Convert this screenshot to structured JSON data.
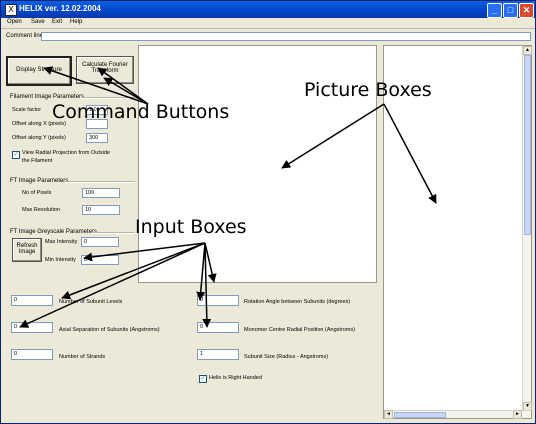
{
  "window": {
    "title": "HELIX ver. 12.02.2004",
    "app_icon": "X",
    "minimize_glyph": "_",
    "maximize_glyph": "□",
    "close_glyph": "✕"
  },
  "menu": [
    "Open",
    "Save",
    "Exit",
    "Help"
  ],
  "comment": {
    "label": "Comment line:",
    "value": ""
  },
  "buttons": {
    "display_structure": "Display Structure",
    "calculate_fourier_line1": "Calculate Fourier",
    "calculate_fourier_line2": "Transform",
    "refresh_line1": "Refresh",
    "refresh_line2": "Image"
  },
  "filament": {
    "group_label": "Filament Image Parameters",
    "scale_label": "Scale factor",
    "scale_value": "1.0",
    "offset_x_label": "Offset along X (pixels)",
    "offset_x_value": "",
    "offset_y_label": "Offset along Y (pixels)",
    "offset_y_value": "300",
    "radial_line1": "View Radial Projection from Outside",
    "radial_line2": "the Filament",
    "radial_checked": true
  },
  "ft_params": {
    "group_label": "FT Image Parameters",
    "pixels_label": "No of Pixels",
    "pixels_value": "100",
    "resolution_label": "Max Resolution",
    "resolution_value": "10"
  },
  "ft_grayscale": {
    "group_label": "FT Image Greyscale Parameters",
    "max_label": "Max Intensity",
    "max_value": "0",
    "min_label": "Min Intensity",
    "min_value": "0"
  },
  "lower_fields": {
    "subunit_levels_label": "Number of Subunit Levels",
    "subunit_levels_value": "0",
    "axial_separation_label": "Axial Separation of Subunits (Angstroms)",
    "axial_separation_value": "0",
    "strands_label": "Number of Strands",
    "strands_value": "0",
    "rotation_angle_label": "Rotation Angle between Subunits (degrees)",
    "rotation_angle_value": "0",
    "monomer_position_label": "Monomer Centre Radial Position (Angstroms)",
    "monomer_position_value": "0",
    "subunit_size_label": "Subunit Size (Radius - Angstroms)",
    "subunit_size_value": "1",
    "right_handed_label": "Helix is Right Handed",
    "right_handed_checked": true
  },
  "annotations": {
    "command_buttons": "Command Buttons",
    "picture_boxes": "Picture Boxes",
    "input_boxes": "Input Boxes"
  },
  "icons": {
    "scroll_up": "▲",
    "scroll_down": "▼",
    "scroll_left": "◄",
    "scroll_right": "►",
    "check": "✓"
  }
}
